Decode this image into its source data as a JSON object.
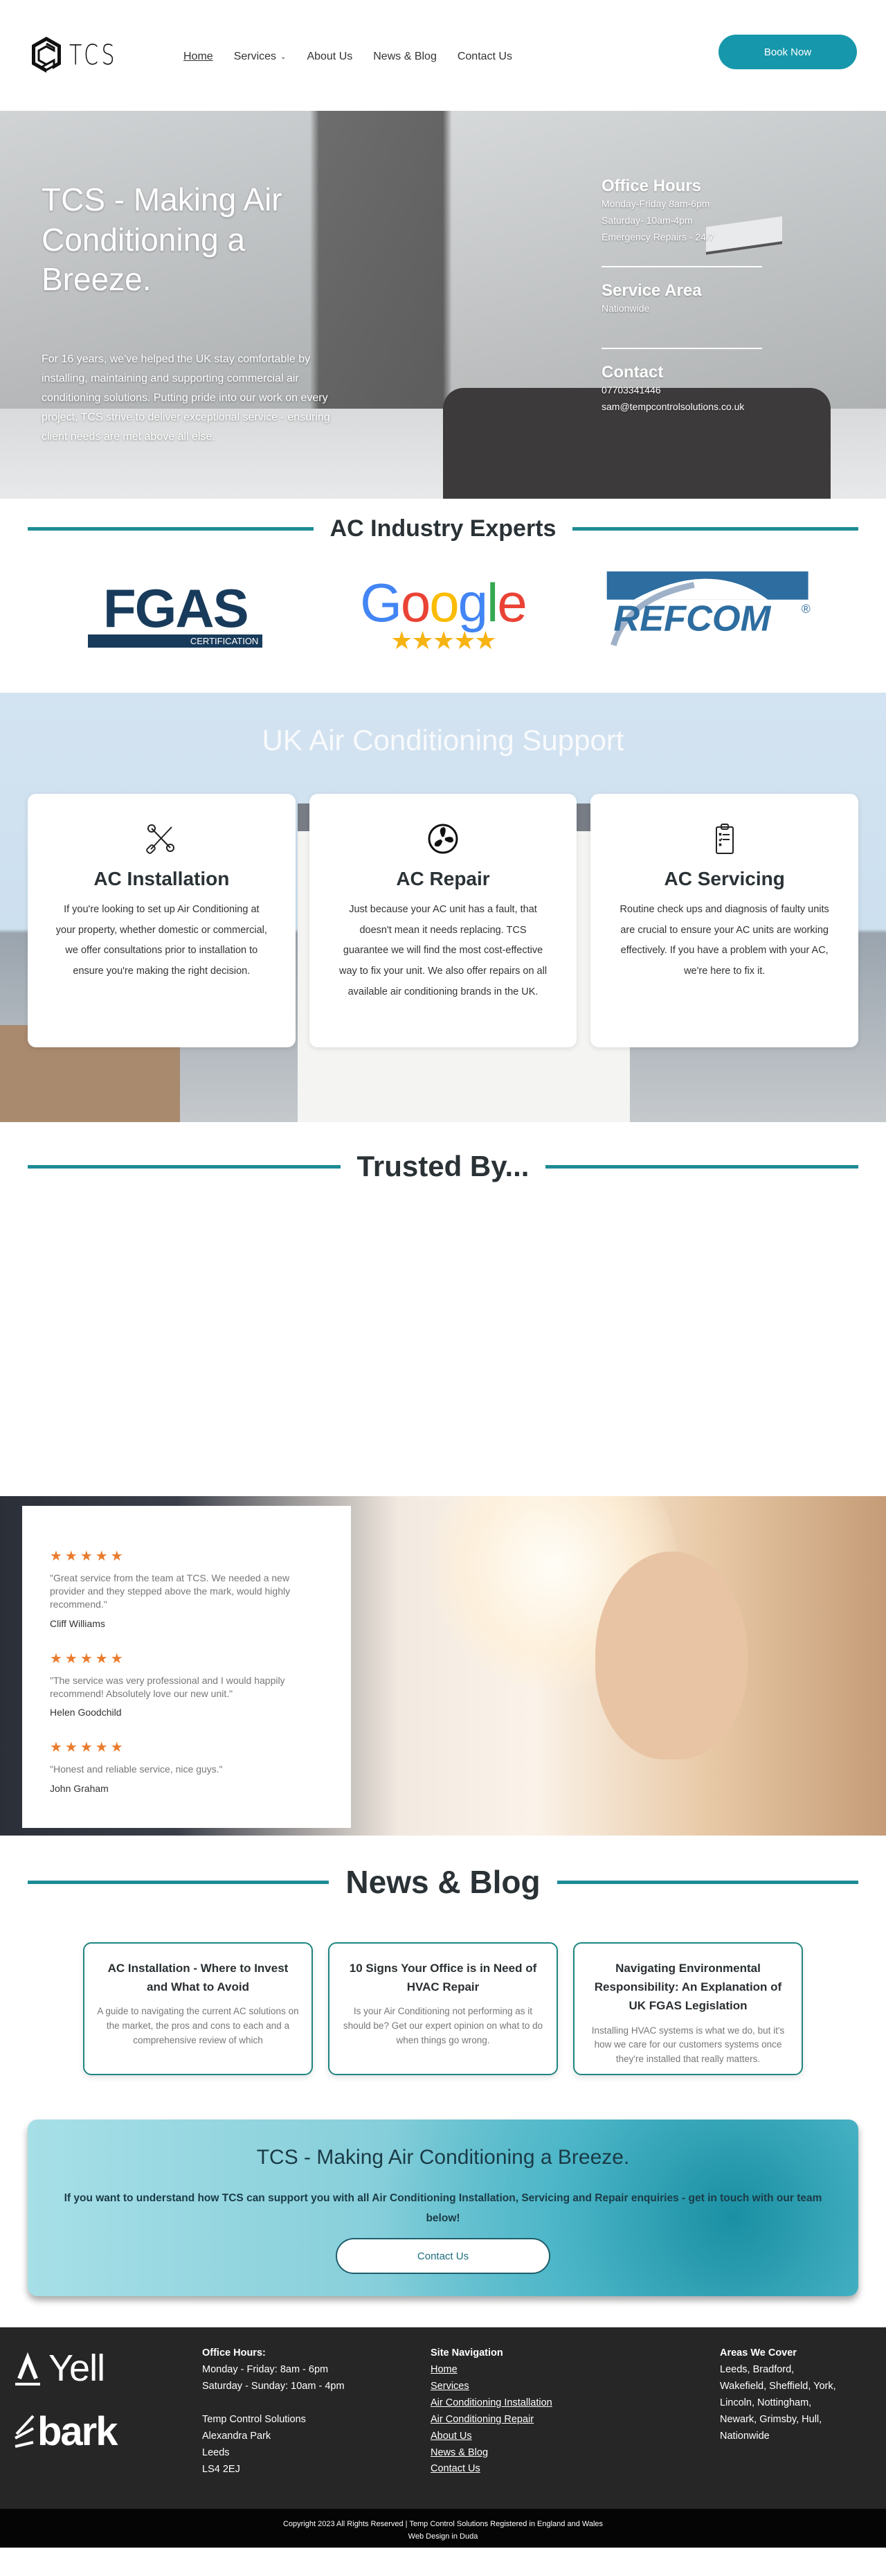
{
  "header": {
    "logo_text": "TCS",
    "nav": [
      {
        "label": "Home",
        "active": true
      },
      {
        "label": "Services",
        "has_dropdown": true
      },
      {
        "label": "About Us"
      },
      {
        "label": "News & Blog"
      },
      {
        "label": "Contact Us"
      }
    ],
    "cta_label": "Book Now",
    "accent_color": "#1797ab"
  },
  "hero": {
    "title": "TCS - Making Air Conditioning a Breeze.",
    "description": "For 16 years, we've helped the UK stay comfortable by installing, maintaining and supporting commercial air conditioning solutions. Putting pride into our work on every project, TCS strive to deliver exceptional service - ensuring client needs are met above all else.",
    "office_hours": {
      "heading": "Office Hours",
      "lines": [
        "Monday-Friday 8am-6pm",
        "Saturday- 10am-4pm",
        "Emergency Repairs - 24/7"
      ]
    },
    "service_area": {
      "heading": "Service Area",
      "value": "Nationwide"
    },
    "contact": {
      "heading": "Contact",
      "phone": "07703341446",
      "email": "sam@tempcontrolsolutions.co.uk"
    }
  },
  "experts": {
    "title": "AC Industry Experts",
    "logos": [
      {
        "name": "FGAS",
        "sub": "CERTIFICATION"
      },
      {
        "name": "Google",
        "rating_stars": 5
      },
      {
        "name": "REFCOM",
        "mark": "®"
      }
    ]
  },
  "services": {
    "title": "UK Air Conditioning Support",
    "cards": [
      {
        "icon": "tools-icon",
        "title": "AC Installation",
        "text": "If you're looking to set up Air Conditioning at your property, whether domestic or commercial, we offer consultations prior to installation to ensure you're making the right decision."
      },
      {
        "icon": "fan-icon",
        "title": "AC Repair",
        "text": "Just because your AC unit has a fault, that doesn't mean it needs replacing. TCS guarantee we will find the most cost-effective way to fix your unit. We also offer repairs on all available air conditioning brands in the UK."
      },
      {
        "icon": "clipboard-checklist-icon",
        "title": "AC Servicing",
        "text": "Routine check ups and diagnosis of faulty units are crucial to ensure your AC units are working effectively. If you have a problem with your AC, we're here to fix it."
      }
    ]
  },
  "trusted": {
    "title": "Trusted By..."
  },
  "reviews": {
    "star_color": "#e97c2e",
    "items": [
      {
        "stars": 5,
        "text": "\"Great service from the team at TCS. We needed a new provider and they stepped above the mark, would highly recommend.\"",
        "name": "Cliff Williams"
      },
      {
        "stars": 5,
        "text": "\"The service was very professional and I would happily recommend! Absolutely love our new unit.\"",
        "name": "Helen Goodchild"
      },
      {
        "stars": 5,
        "text": "\"Honest and reliable service, nice guys.\"",
        "name": "John Graham"
      }
    ]
  },
  "news": {
    "title": "News & Blog",
    "posts": [
      {
        "title": "AC Installation - Where to Invest and What to Avoid",
        "excerpt": "A guide to navigating the current AC solutions on the market, the pros and cons to each and a comprehensive review of which"
      },
      {
        "title": "10 Signs Your Office is in Need of HVAC Repair",
        "excerpt": "Is your Air Conditioning not performing as it should be? Get our expert opinion on what to do when things go wrong."
      },
      {
        "title": "Navigating Environmental Responsibility: An Explanation of UK FGAS Legislation",
        "excerpt": "Installing HVAC systems is what we do, but it's how we care for our customers systems once they're installed that really matters."
      }
    ]
  },
  "cta": {
    "title": "TCS - Making Air Conditioning a Breeze.",
    "text": "If you want to understand how TCS can support you with all Air Conditioning Installation, Servicing and Repair enquiries - get in touch with our team below!",
    "button_label": "Contact Us"
  },
  "footer": {
    "partner_logos": [
      "Yell",
      "bark"
    ],
    "office_hours": {
      "heading": "Office Hours:",
      "lines": [
        "Monday - Friday: 8am - 6pm",
        "Saturday - Sunday: 10am - 4pm"
      ]
    },
    "address": [
      "Temp Control Solutions",
      "Alexandra Park",
      "Leeds",
      "LS4 2EJ"
    ],
    "site_nav": {
      "heading": "Site Navigation",
      "links": [
        "Home",
        "Services",
        "Air Conditioning Installation",
        "Air Conditioning Repair",
        "About Us",
        "News & Blog",
        "Contact Us"
      ]
    },
    "areas": {
      "heading": "Areas We Cover",
      "lines": [
        "Leeds, Bradford,",
        "Wakefield, Sheffield, York,",
        "Lincoln, Nottingham,",
        "Newark, Grimsby,  Hull,",
        "Nationwide"
      ]
    },
    "copyright": "Copyright 2023 All Rights Reserved | Temp Control Solutions Registered in England and Wales",
    "credit": "Web Design in Duda"
  }
}
